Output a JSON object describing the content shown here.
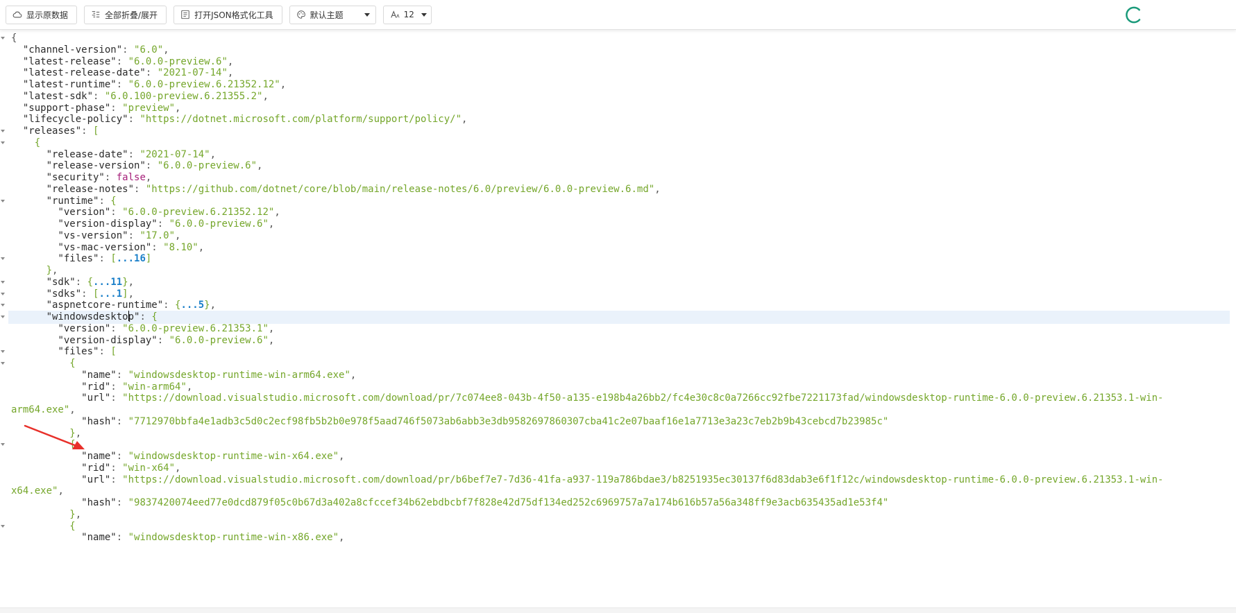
{
  "toolbar": {
    "show_raw_label": "显示原数据",
    "fold_toggle_label": "全部折叠/展开",
    "open_formatter_label": "打开JSON格式化工具",
    "theme_value": "默认主题",
    "font_size_value": "12"
  },
  "colors": {
    "key": "#2b2b2b",
    "string": "#74a62a",
    "boolean": "#a6207a",
    "collapsed_count": "#1a7fc9",
    "active_line": "#eaf2fb",
    "spinner": "#1a9a7a",
    "arrow": "#e8302a"
  },
  "icons": {
    "show_raw": "cloud-icon",
    "fold_toggle": "fold-list-icon",
    "open_formatter": "json-tool-icon",
    "theme": "palette-icon",
    "font_size": "font-size-icon",
    "loading": "spinner-icon",
    "pointer": "red-arrow-icon"
  },
  "json_lines": [
    {
      "fold": true,
      "tokens": [
        [
          "p",
          "{"
        ]
      ]
    },
    {
      "fold": false,
      "tokens": [
        [
          "p",
          "  "
        ],
        [
          "k",
          "\"channel-version\""
        ],
        [
          "p",
          ": "
        ],
        [
          "s",
          "\"6.0\""
        ],
        [
          "p",
          ","
        ]
      ]
    },
    {
      "fold": false,
      "tokens": [
        [
          "p",
          "  "
        ],
        [
          "k",
          "\"latest-release\""
        ],
        [
          "p",
          ": "
        ],
        [
          "s",
          "\"6.0.0-preview.6\""
        ],
        [
          "p",
          ","
        ]
      ]
    },
    {
      "fold": false,
      "tokens": [
        [
          "p",
          "  "
        ],
        [
          "k",
          "\"latest-release-date\""
        ],
        [
          "p",
          ": "
        ],
        [
          "s",
          "\"2021-07-14\""
        ],
        [
          "p",
          ","
        ]
      ]
    },
    {
      "fold": false,
      "tokens": [
        [
          "p",
          "  "
        ],
        [
          "k",
          "\"latest-runtime\""
        ],
        [
          "p",
          ": "
        ],
        [
          "s",
          "\"6.0.0-preview.6.21352.12\""
        ],
        [
          "p",
          ","
        ]
      ]
    },
    {
      "fold": false,
      "tokens": [
        [
          "p",
          "  "
        ],
        [
          "k",
          "\"latest-sdk\""
        ],
        [
          "p",
          ": "
        ],
        [
          "s",
          "\"6.0.100-preview.6.21355.2\""
        ],
        [
          "p",
          ","
        ]
      ]
    },
    {
      "fold": false,
      "tokens": [
        [
          "p",
          "  "
        ],
        [
          "k",
          "\"support-phase\""
        ],
        [
          "p",
          ": "
        ],
        [
          "s",
          "\"preview\""
        ],
        [
          "p",
          ","
        ]
      ]
    },
    {
      "fold": false,
      "tokens": [
        [
          "p",
          "  "
        ],
        [
          "k",
          "\"lifecycle-policy\""
        ],
        [
          "p",
          ": "
        ],
        [
          "s",
          "\"https://dotnet.microsoft.com/platform/support/policy/\""
        ],
        [
          "p",
          ","
        ]
      ]
    },
    {
      "fold": true,
      "tokens": [
        [
          "p",
          "  "
        ],
        [
          "k",
          "\"releases\""
        ],
        [
          "p",
          ": "
        ],
        [
          "bracket",
          "["
        ]
      ]
    },
    {
      "fold": true,
      "tokens": [
        [
          "p",
          "    "
        ],
        [
          "bracket",
          "{"
        ]
      ]
    },
    {
      "fold": false,
      "tokens": [
        [
          "p",
          "      "
        ],
        [
          "k",
          "\"release-date\""
        ],
        [
          "p",
          ": "
        ],
        [
          "s",
          "\"2021-07-14\""
        ],
        [
          "p",
          ","
        ]
      ]
    },
    {
      "fold": false,
      "tokens": [
        [
          "p",
          "      "
        ],
        [
          "k",
          "\"release-version\""
        ],
        [
          "p",
          ": "
        ],
        [
          "s",
          "\"6.0.0-preview.6\""
        ],
        [
          "p",
          ","
        ]
      ]
    },
    {
      "fold": false,
      "tokens": [
        [
          "p",
          "      "
        ],
        [
          "k",
          "\"security\""
        ],
        [
          "p",
          ": "
        ],
        [
          "b",
          "false"
        ],
        [
          "p",
          ","
        ]
      ]
    },
    {
      "fold": false,
      "tokens": [
        [
          "p",
          "      "
        ],
        [
          "k",
          "\"release-notes\""
        ],
        [
          "p",
          ": "
        ],
        [
          "s",
          "\"https://github.com/dotnet/core/blob/main/release-notes/6.0/preview/6.0.0-preview.6.md\""
        ],
        [
          "p",
          ","
        ]
      ]
    },
    {
      "fold": true,
      "tokens": [
        [
          "p",
          "      "
        ],
        [
          "k",
          "\"runtime\""
        ],
        [
          "p",
          ": "
        ],
        [
          "bracket",
          "{"
        ]
      ]
    },
    {
      "fold": false,
      "tokens": [
        [
          "p",
          "        "
        ],
        [
          "k",
          "\"version\""
        ],
        [
          "p",
          ": "
        ],
        [
          "s",
          "\"6.0.0-preview.6.21352.12\""
        ],
        [
          "p",
          ","
        ]
      ]
    },
    {
      "fold": false,
      "tokens": [
        [
          "p",
          "        "
        ],
        [
          "k",
          "\"version-display\""
        ],
        [
          "p",
          ": "
        ],
        [
          "s",
          "\"6.0.0-preview.6\""
        ],
        [
          "p",
          ","
        ]
      ]
    },
    {
      "fold": false,
      "tokens": [
        [
          "p",
          "        "
        ],
        [
          "k",
          "\"vs-version\""
        ],
        [
          "p",
          ": "
        ],
        [
          "s",
          "\"17.0\""
        ],
        [
          "p",
          ","
        ]
      ]
    },
    {
      "fold": false,
      "tokens": [
        [
          "p",
          "        "
        ],
        [
          "k",
          "\"vs-mac-version\""
        ],
        [
          "p",
          ": "
        ],
        [
          "s",
          "\"8.10\""
        ],
        [
          "p",
          ","
        ]
      ]
    },
    {
      "fold": true,
      "tokens": [
        [
          "p",
          "        "
        ],
        [
          "k",
          "\"files\""
        ],
        [
          "p",
          ": "
        ],
        [
          "bracket",
          "["
        ],
        [
          "c",
          "...16"
        ],
        [
          "bracket",
          "]"
        ]
      ]
    },
    {
      "fold": false,
      "tokens": [
        [
          "p",
          "      "
        ],
        [
          "bracket",
          "}"
        ],
        [
          "p",
          ","
        ]
      ]
    },
    {
      "fold": true,
      "tokens": [
        [
          "p",
          "      "
        ],
        [
          "k",
          "\"sdk\""
        ],
        [
          "p",
          ": "
        ],
        [
          "bracket",
          "{"
        ],
        [
          "c",
          "...11"
        ],
        [
          "bracket",
          "}"
        ],
        [
          "p",
          ","
        ]
      ]
    },
    {
      "fold": true,
      "tokens": [
        [
          "p",
          "      "
        ],
        [
          "k",
          "\"sdks\""
        ],
        [
          "p",
          ": "
        ],
        [
          "bracket",
          "["
        ],
        [
          "c",
          "...1"
        ],
        [
          "bracket",
          "]"
        ],
        [
          "p",
          ","
        ]
      ]
    },
    {
      "fold": true,
      "tokens": [
        [
          "p",
          "      "
        ],
        [
          "k",
          "\"aspnetcore-runtime\""
        ],
        [
          "p",
          ": "
        ],
        [
          "bracket",
          "{"
        ],
        [
          "c",
          "...5"
        ],
        [
          "bracket",
          "}"
        ],
        [
          "p",
          ","
        ]
      ]
    },
    {
      "fold": true,
      "active": true,
      "cursor_after": 14,
      "tokens": [
        [
          "p",
          "      "
        ],
        [
          "k",
          "\"windowsdesktop\""
        ],
        [
          "p",
          ": "
        ],
        [
          "bracket",
          "{"
        ]
      ]
    },
    {
      "fold": false,
      "tokens": [
        [
          "p",
          "        "
        ],
        [
          "k",
          "\"version\""
        ],
        [
          "p",
          ": "
        ],
        [
          "s",
          "\"6.0.0-preview.6.21353.1\""
        ],
        [
          "p",
          ","
        ]
      ]
    },
    {
      "fold": false,
      "tokens": [
        [
          "p",
          "        "
        ],
        [
          "k",
          "\"version-display\""
        ],
        [
          "p",
          ": "
        ],
        [
          "s",
          "\"6.0.0-preview.6\""
        ],
        [
          "p",
          ","
        ]
      ]
    },
    {
      "fold": true,
      "tokens": [
        [
          "p",
          "        "
        ],
        [
          "k",
          "\"files\""
        ],
        [
          "p",
          ": "
        ],
        [
          "bracket",
          "["
        ]
      ]
    },
    {
      "fold": true,
      "tokens": [
        [
          "p",
          "          "
        ],
        [
          "bracket",
          "{"
        ]
      ]
    },
    {
      "fold": false,
      "tokens": [
        [
          "p",
          "            "
        ],
        [
          "k",
          "\"name\""
        ],
        [
          "p",
          ": "
        ],
        [
          "s",
          "\"windowsdesktop-runtime-win-arm64.exe\""
        ],
        [
          "p",
          ","
        ]
      ]
    },
    {
      "fold": false,
      "tokens": [
        [
          "p",
          "            "
        ],
        [
          "k",
          "\"rid\""
        ],
        [
          "p",
          ": "
        ],
        [
          "s",
          "\"win-arm64\""
        ],
        [
          "p",
          ","
        ]
      ]
    },
    {
      "fold": false,
      "tokens": [
        [
          "p",
          "            "
        ],
        [
          "k",
          "\"url\""
        ],
        [
          "p",
          ": "
        ],
        [
          "s",
          "\"https://download.visualstudio.microsoft.com/download/pr/7c074ee8-043b-4f50-a135-e198b4a26bb2/fc4e30c8c0a7266cc92fbe7221173fad/windowsdesktop-runtime-6.0.0-preview.6.21353.1-win-"
        ]
      ]
    },
    {
      "fold": false,
      "wrap": true,
      "tokens": [
        [
          "s",
          "arm64.exe\""
        ],
        [
          "p",
          ","
        ]
      ]
    },
    {
      "fold": false,
      "tokens": [
        [
          "p",
          "            "
        ],
        [
          "k",
          "\"hash\""
        ],
        [
          "p",
          ": "
        ],
        [
          "s",
          "\"7712970bbfa4e1adb3c5d0c2ecf98fb5b2b0e978f5aad746f5073ab6abb3e3db9582697860307cba41c2e07baaf16e1a7713e3a23c7eb2b9b43cebcd7b23985c\""
        ]
      ]
    },
    {
      "fold": false,
      "tokens": [
        [
          "p",
          "          "
        ],
        [
          "bracket",
          "}"
        ],
        [
          "p",
          ","
        ]
      ]
    },
    {
      "fold": true,
      "tokens": [
        [
          "p",
          "          "
        ],
        [
          "bracket",
          "{"
        ]
      ]
    },
    {
      "fold": false,
      "tokens": [
        [
          "p",
          "            "
        ],
        [
          "k",
          "\"name\""
        ],
        [
          "p",
          ": "
        ],
        [
          "s",
          "\"windowsdesktop-runtime-win-x64.exe\""
        ],
        [
          "p",
          ","
        ]
      ]
    },
    {
      "fold": false,
      "tokens": [
        [
          "p",
          "            "
        ],
        [
          "k",
          "\"rid\""
        ],
        [
          "p",
          ": "
        ],
        [
          "s",
          "\"win-x64\""
        ],
        [
          "p",
          ","
        ]
      ]
    },
    {
      "fold": false,
      "tokens": [
        [
          "p",
          "            "
        ],
        [
          "k",
          "\"url\""
        ],
        [
          "p",
          ": "
        ],
        [
          "s",
          "\"https://download.visualstudio.microsoft.com/download/pr/b6bef7e7-7d36-41fa-a937-119a786bdae3/b8251935ec30137f6d83dab3e6f1f12c/windowsdesktop-runtime-6.0.0-preview.6.21353.1-win-"
        ]
      ]
    },
    {
      "fold": false,
      "wrap": true,
      "tokens": [
        [
          "s",
          "x64.exe\""
        ],
        [
          "p",
          ","
        ]
      ]
    },
    {
      "fold": false,
      "tokens": [
        [
          "p",
          "            "
        ],
        [
          "k",
          "\"hash\""
        ],
        [
          "p",
          ": "
        ],
        [
          "s",
          "\"9837420074eed77e0dcd879f05c0b67d3a402a8cfccef34b62ebdbcbf7f828e42d75df134ed252c6969757a7a174b616b57a56a348ff9e3acb635435ad1e53f4\""
        ]
      ]
    },
    {
      "fold": false,
      "tokens": [
        [
          "p",
          "          "
        ],
        [
          "bracket",
          "}"
        ],
        [
          "p",
          ","
        ]
      ]
    },
    {
      "fold": true,
      "tokens": [
        [
          "p",
          "          "
        ],
        [
          "bracket",
          "{"
        ]
      ]
    },
    {
      "fold": false,
      "tokens": [
        [
          "p",
          "            "
        ],
        [
          "k",
          "\"name\""
        ],
        [
          "p",
          ": "
        ],
        [
          "s",
          "\"windowsdesktop-runtime-win-x86.exe\""
        ],
        [
          "p",
          ","
        ]
      ]
    }
  ]
}
